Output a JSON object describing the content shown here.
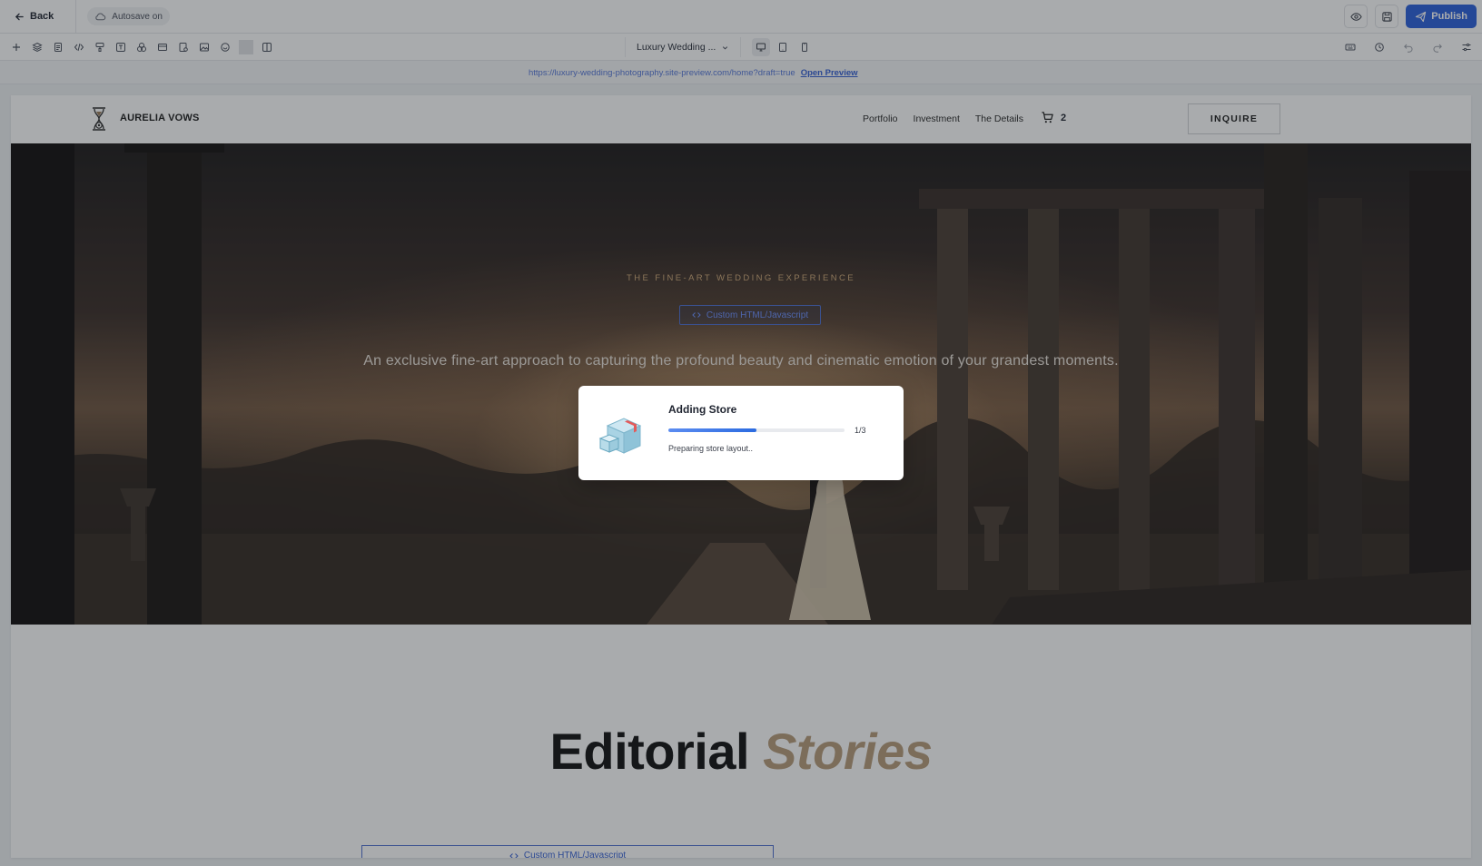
{
  "topbar": {
    "back_label": "Back",
    "autosave_label": "Autosave on",
    "publish_label": "Publish"
  },
  "toolbar": {
    "page_name": "Luxury Wedding ...",
    "tools": [
      "plus-icon",
      "layers-icon",
      "page-icon",
      "code-icon",
      "paint-icon",
      "text-icon",
      "shapes-icon",
      "section-icon",
      "form-icon",
      "image-icon",
      "sticker-icon",
      "columns-icon"
    ],
    "devices": [
      "desktop-icon",
      "tablet-icon",
      "mobile-icon"
    ],
    "active_device": "desktop",
    "right_tools": [
      "keyboard-icon",
      "history-icon",
      "undo-icon",
      "redo-icon",
      "settings-icon"
    ]
  },
  "urlstrip": {
    "url": "https://luxury-wedding-photography.site-preview.com/home?draft=true",
    "link": "Open Preview"
  },
  "site": {
    "brand": "AURELIA VOWS",
    "nav": [
      "Portfolio",
      "Investment",
      "The Details"
    ],
    "cart_count": "2",
    "inquire": "INQUIRE"
  },
  "hero": {
    "eyebrow": "THE FINE-ART WEDDING EXPERIENCE",
    "custom_tag": "Custom HTML/Javascript",
    "subtitle": "An exclusive fine-art approach to capturing the profound beauty and cinematic emotion of your grandest moments."
  },
  "editorial": {
    "word1": "Editorial",
    "word2": "Stories",
    "custom_tag": "Custom HTML/Javascript"
  },
  "modal": {
    "title": "Adding Store",
    "progress_fraction": 0.5,
    "progress_label": "1/3",
    "status": "Preparing store layout.."
  },
  "colors": {
    "accent": "#2b5fdc",
    "gold": "#b79b7a",
    "eyebrow": "#cfa978"
  }
}
